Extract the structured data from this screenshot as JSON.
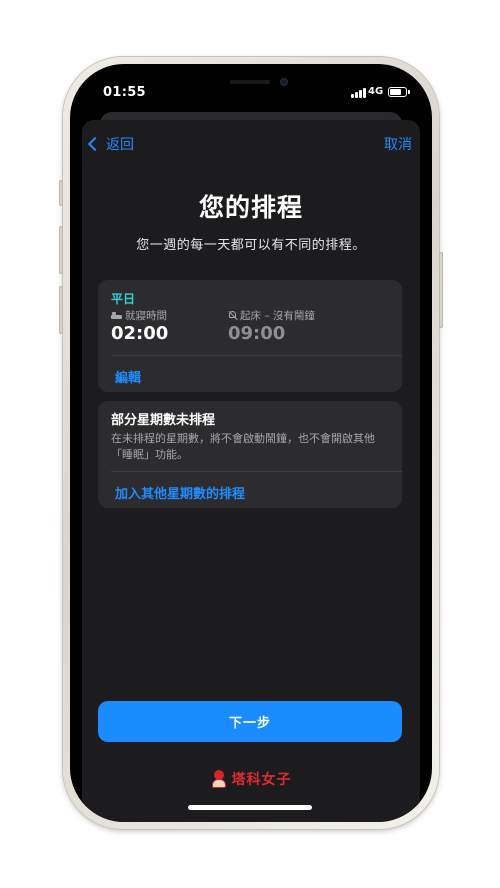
{
  "status_bar": {
    "time": "01:55",
    "network": "4G"
  },
  "nav": {
    "back_label": "返回",
    "cancel_label": "取消"
  },
  "header": {
    "title": "您的排程",
    "subtitle": "您一週的每一天都可以有不同的排程。"
  },
  "schedule_card": {
    "days_label": "平日",
    "bedtime_label": "就寢時間",
    "bedtime_value": "02:00",
    "wake_label": "起床 – 沒有鬧鐘",
    "wake_value": "09:00",
    "edit_label": "編輯"
  },
  "unscheduled_card": {
    "title": "部分星期數未排程",
    "description": "在未排程的星期數，將不會啟動鬧鐘，也不會開啟其他「睡眠」功能。",
    "add_label": "加入其他星期數的排程"
  },
  "footer": {
    "next_label": "下一步",
    "watermark": "塔科女子"
  },
  "colors": {
    "accent": "#1f8cff",
    "weekday": "#32d0d0",
    "sheet_background": "#1c1c1e",
    "card_background": "#2c2c2e",
    "watermark": "#e02a33"
  }
}
